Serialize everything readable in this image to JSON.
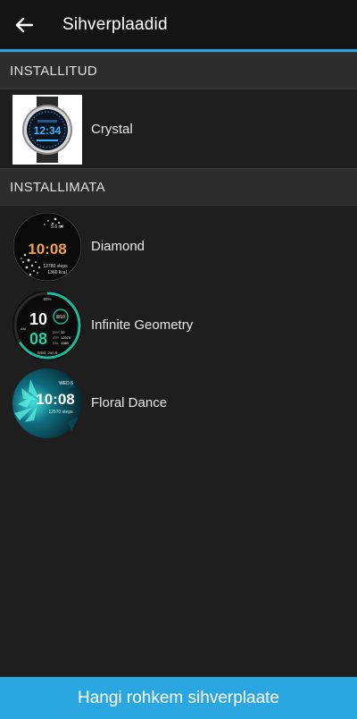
{
  "header": {
    "title": "Sihverplaadid"
  },
  "sections": {
    "installed": {
      "label": "INSTALLITUD"
    },
    "not_installed": {
      "label": "INSTALLIMATA"
    }
  },
  "installed_faces": [
    {
      "name": "Crystal",
      "thumb_time": "12:34"
    }
  ],
  "available_faces": [
    {
      "name": "Diamond",
      "thumb_time": "10:08",
      "thumb_line1": "12780 steps",
      "thumb_line2": "1360 kcal",
      "thumb_top": "5.6 mi"
    },
    {
      "name": "Infinite Geometry",
      "thumb_hour": "10",
      "thumb_min": "08",
      "thumb_ampm": "AM",
      "thumb_date": "Wed, Jun 6",
      "thumb_v1": "32",
      "thumb_v2": "12570",
      "thumb_v3": "1360",
      "thumb_k1": "DIST",
      "thumb_k2": "STP",
      "thumb_k3": "CAL",
      "thumb_ring": "8/10",
      "thumb_pct": "65%"
    },
    {
      "name": "Floral Dance",
      "thumb_time": "10:08",
      "thumb_date": "WED 6",
      "thumb_steps": "12570 steps"
    }
  ],
  "footer": {
    "button_label": "Hangi rohkem sihverplaate"
  },
  "colors": {
    "accent": "#2aa6e0",
    "appbar": "#141414",
    "background": "#1e1e1e",
    "section_header": "#2c2c2c"
  }
}
